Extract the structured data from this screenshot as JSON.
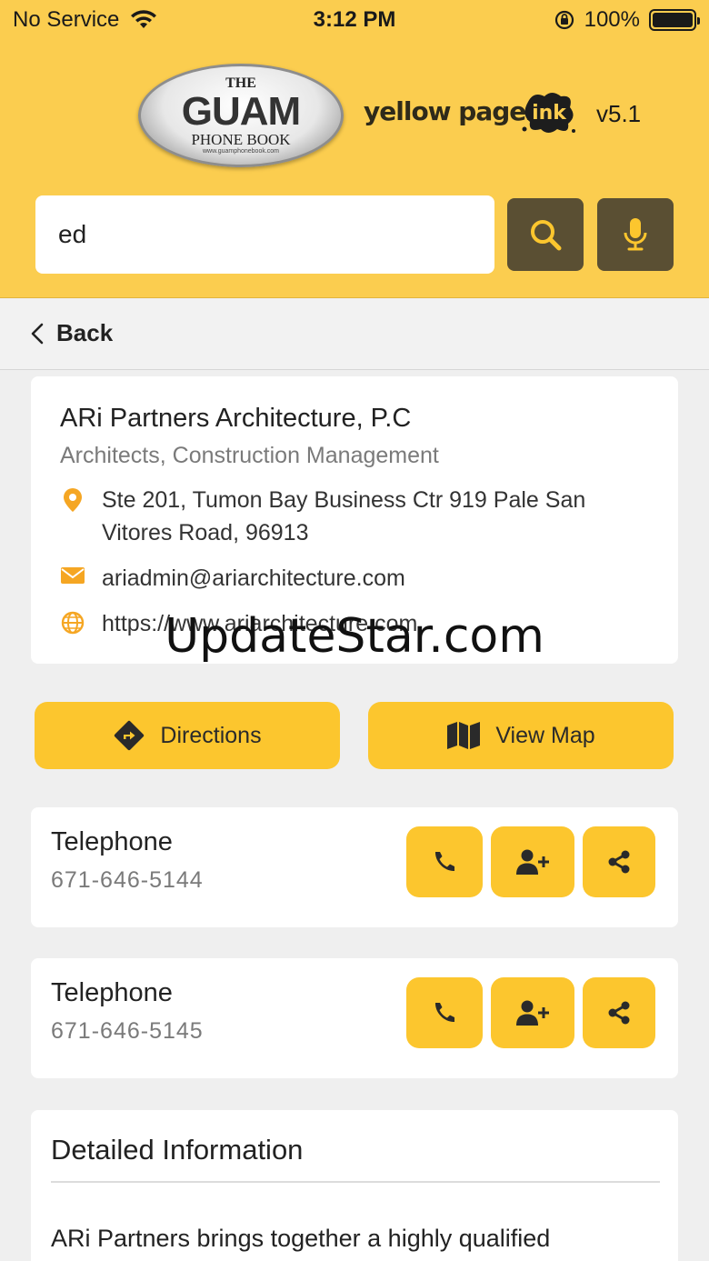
{
  "status": {
    "carrier": "No Service",
    "time": "3:12 PM",
    "battery": "100%"
  },
  "header": {
    "logo_the": "THE",
    "logo_guam": "GUAM",
    "logo_phone": "PHONE BOOK",
    "logo_url": "www.guamphonebook.com",
    "yellow_pages": "yellow pages",
    "ink": "ink",
    "version": "v5.1",
    "search_value": "ed"
  },
  "nav": {
    "back_label": "Back"
  },
  "business": {
    "name": "ARi Partners Architecture, P.C",
    "category": "Architects, Construction Management",
    "address_line1": "Ste 201, Tumon Bay Business Ctr 919 Pale San",
    "address_line2": "Vitores Road, 96913",
    "email": "ariadmin@ariarchitecture.com",
    "website": "https://www.ariarchitecture.com"
  },
  "actions": {
    "directions": "Directions",
    "view_map": "View Map"
  },
  "phones": [
    {
      "label": "Telephone",
      "number": "671-646-5144"
    },
    {
      "label": "Telephone",
      "number": "671-646-5145"
    }
  ],
  "details": {
    "title": "Detailed Information",
    "text": "ARi Partners brings together a highly qualified"
  },
  "watermark": "UpdateStar.com",
  "colors": {
    "brand_yellow": "#fbcd4f",
    "button_yellow": "#fcc62e",
    "search_button": "#5a4f33",
    "icon_orange": "#f5a623"
  }
}
